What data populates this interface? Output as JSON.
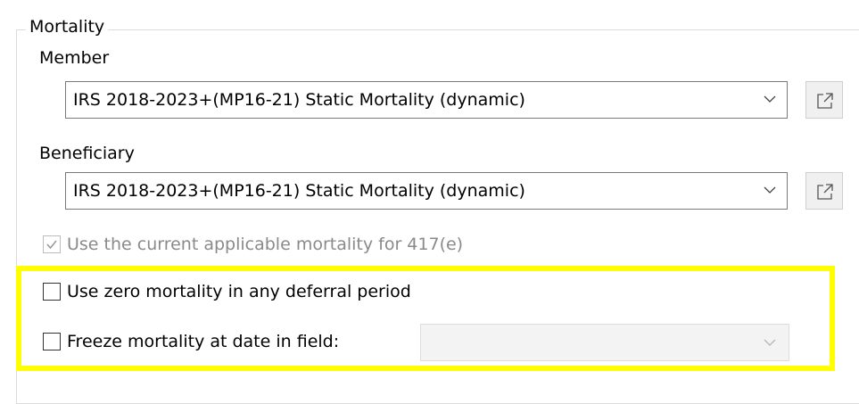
{
  "mortality": {
    "group_title": "Mortality",
    "member": {
      "label": "Member",
      "selected": "IRS 2018-2023+(MP16-21) Static Mortality (dynamic)"
    },
    "beneficiary": {
      "label": "Beneficiary",
      "selected": "IRS 2018-2023+(MP16-21) Static Mortality (dynamic)"
    },
    "use_current_417e": {
      "label": "Use the current applicable mortality for 417(e)",
      "checked": true,
      "enabled": false
    },
    "use_zero_mortality": {
      "label": "Use zero mortality in any deferral period",
      "checked": false
    },
    "freeze_mortality": {
      "label": "Freeze mortality at date in field:",
      "checked": false,
      "field_value": ""
    }
  },
  "icons": {
    "combo_arrow": "chevron-down-icon",
    "open_button": "open-external-icon",
    "checkmark": "checkmark-icon"
  },
  "colors": {
    "highlight": "#ffff00",
    "disabled_text": "#8a8a8a",
    "border": "#7a7a7a"
  }
}
